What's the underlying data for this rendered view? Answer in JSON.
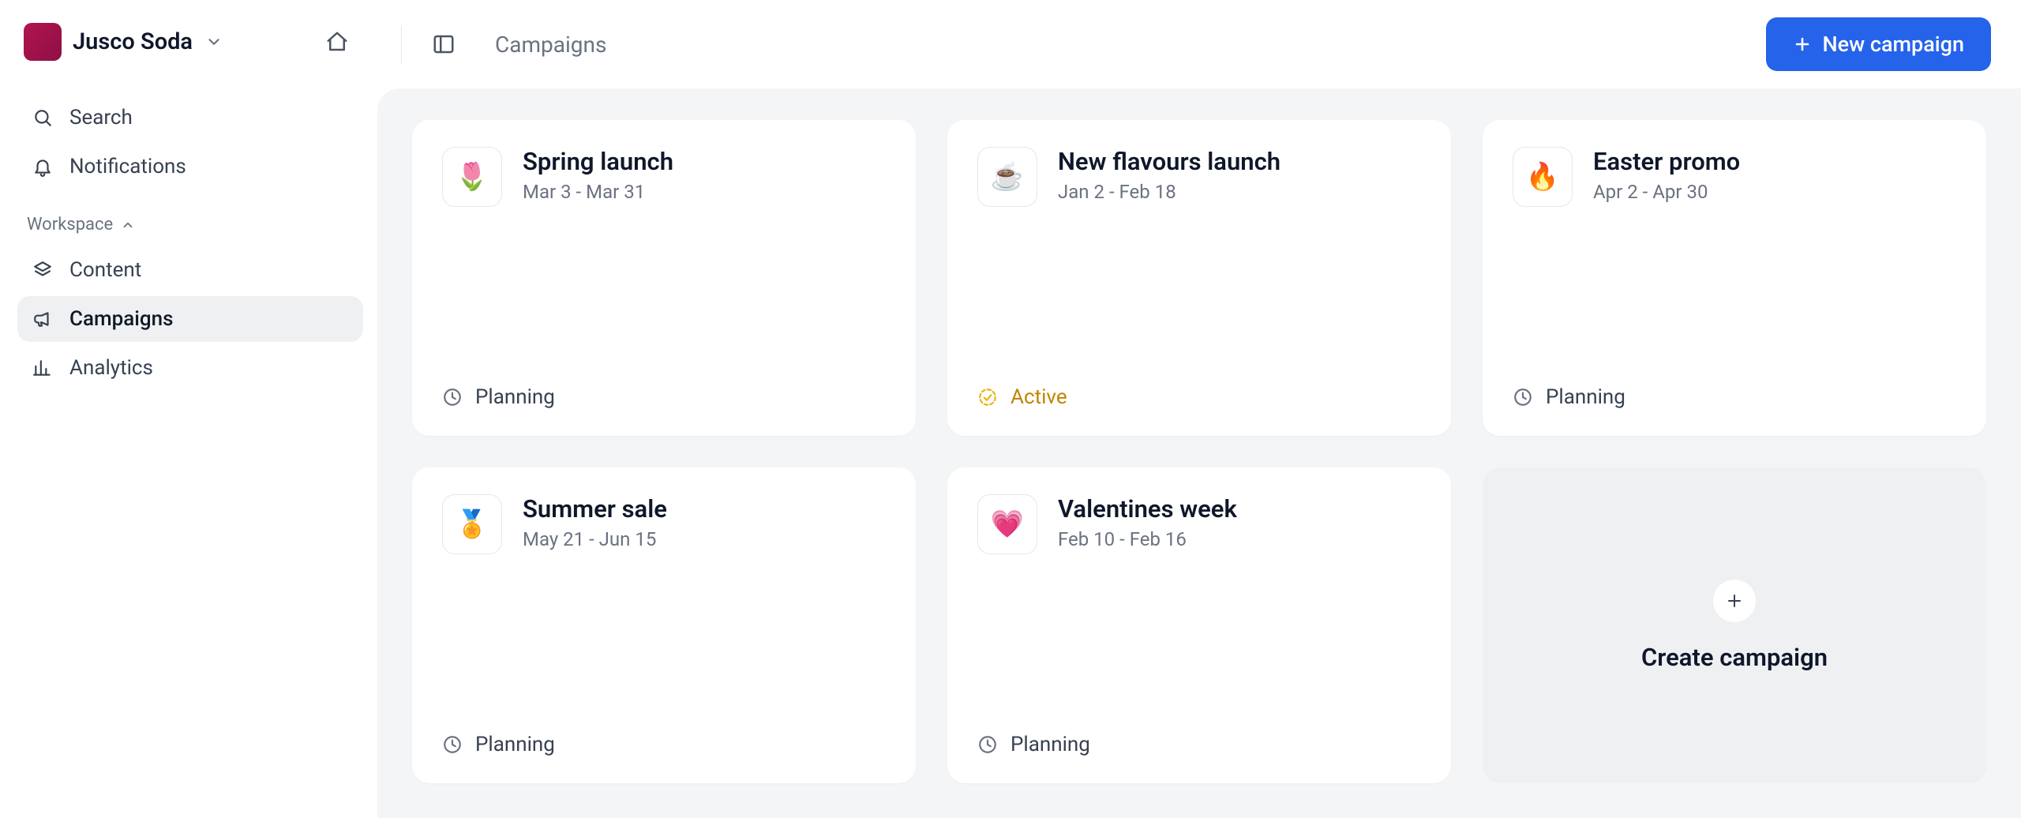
{
  "workspace": {
    "name": "Jusco Soda",
    "section_label": "Workspace"
  },
  "sidebar": {
    "search": "Search",
    "notifications": "Notifications",
    "nav": {
      "content": "Content",
      "campaigns": "Campaigns",
      "analytics": "Analytics"
    }
  },
  "header": {
    "breadcrumb": "Campaigns",
    "new_campaign": "New campaign"
  },
  "campaigns": [
    {
      "icon": "🌷",
      "title": "Spring launch",
      "dates": "Mar 3 - Mar 31",
      "status": "Planning",
      "active": false
    },
    {
      "icon": "☕",
      "title": "New flavours launch",
      "dates": "Jan 2 - Feb 18",
      "status": "Active",
      "active": true
    },
    {
      "icon": "🔥",
      "title": "Easter promo",
      "dates": "Apr 2 - Apr 30",
      "status": "Planning",
      "active": false
    },
    {
      "icon": "🏅",
      "title": "Summer sale",
      "dates": "May 21 - Jun 15",
      "status": "Planning",
      "active": false
    },
    {
      "icon": "💗",
      "title": "Valentines week",
      "dates": "Feb 10 - Feb 16",
      "status": "Planning",
      "active": false
    }
  ],
  "create_card": {
    "label": "Create campaign"
  }
}
